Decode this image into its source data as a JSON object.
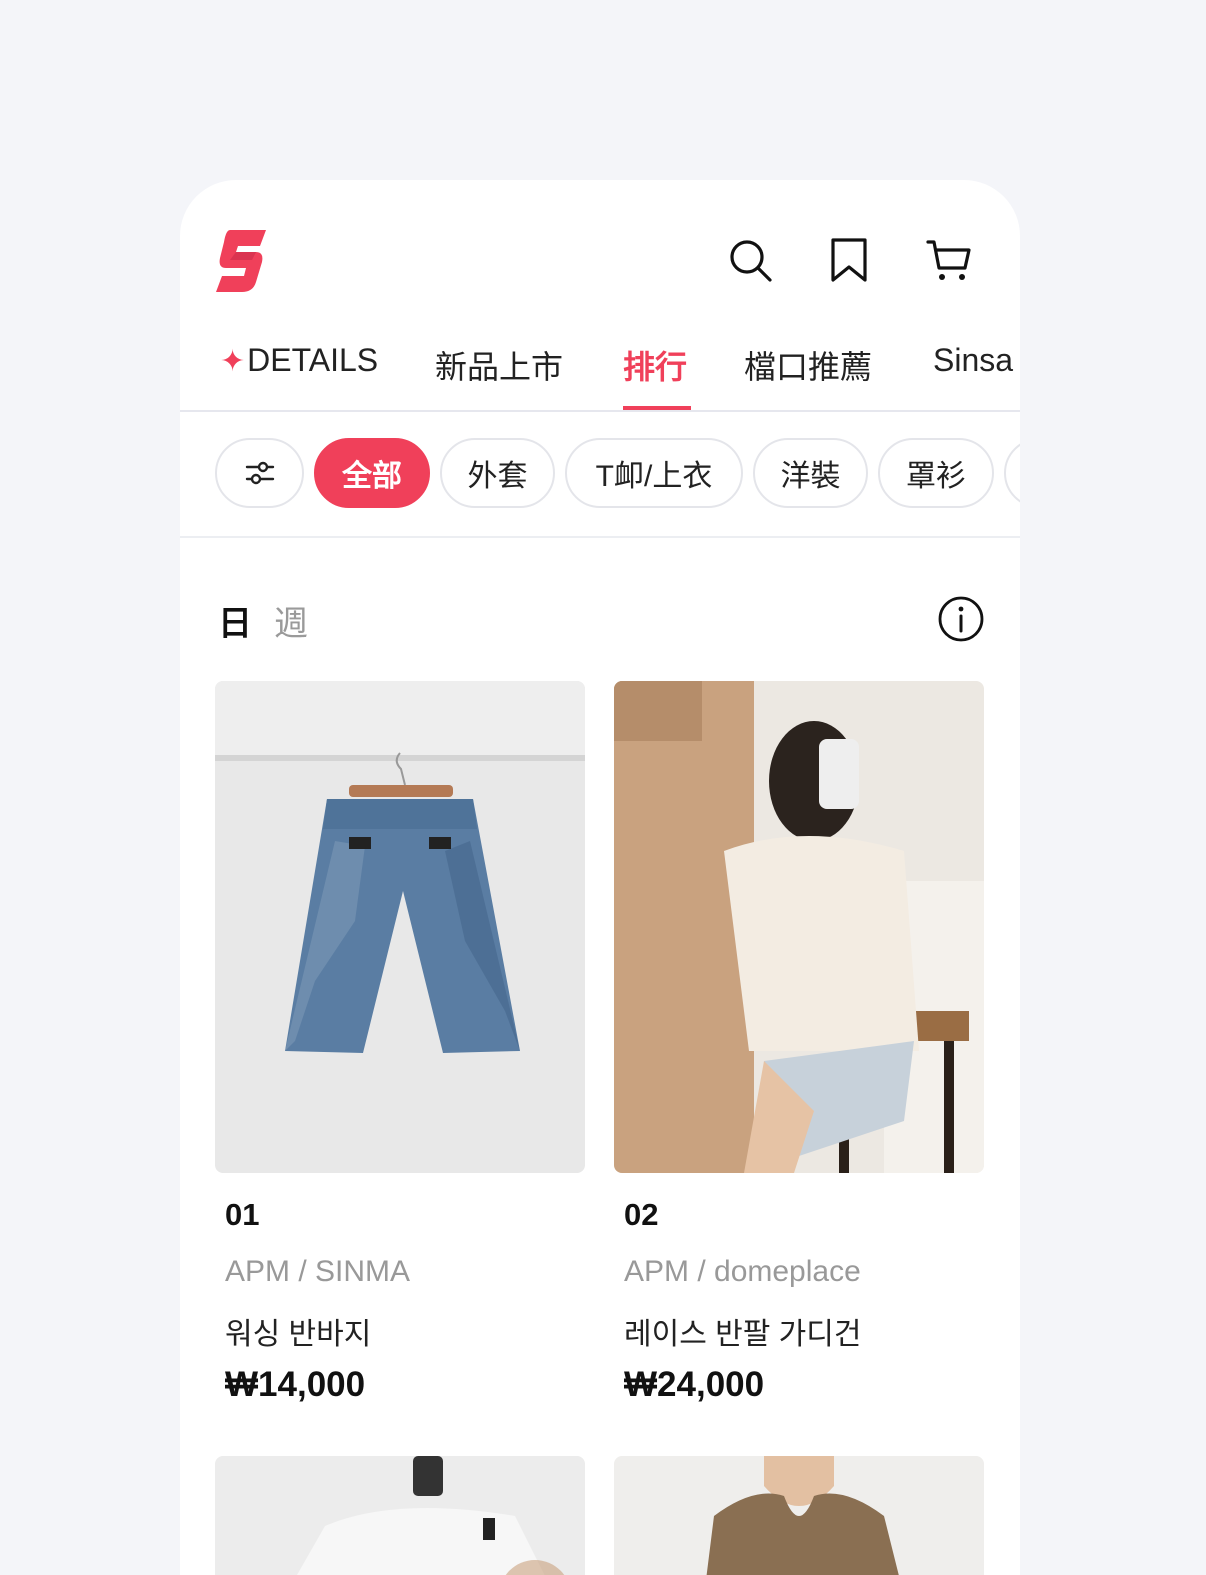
{
  "header": {
    "logo_icon": "sinsang-s-logo",
    "icons": [
      "search-icon",
      "bookmark-icon",
      "cart-icon"
    ]
  },
  "tabs": [
    {
      "label": "DETAILS",
      "icon": "sparkle-icon"
    },
    {
      "label": "新品上市"
    },
    {
      "label": "排行",
      "active": true
    },
    {
      "label": "檔口推薦"
    },
    {
      "label": "Sinsa"
    }
  ],
  "chips": {
    "filter_icon": "sliders-icon",
    "items": [
      {
        "label": "全部",
        "active": true
      },
      {
        "label": "外套"
      },
      {
        "label": "T卹/上衣"
      },
      {
        "label": "洋裝"
      },
      {
        "label": "罩衫"
      }
    ]
  },
  "period": {
    "day": "日",
    "week": "週",
    "info_icon": "info-icon"
  },
  "products": [
    {
      "rank": "01",
      "brand": "APM / SINMA",
      "name": "워싱 반바지",
      "price": "₩14,000"
    },
    {
      "rank": "02",
      "brand": "APM / domeplace",
      "name": "레이스 반팔 가디건",
      "price": "₩24,000"
    }
  ],
  "colors": {
    "accent": "#f0405a",
    "background": "#f4f5f9"
  }
}
